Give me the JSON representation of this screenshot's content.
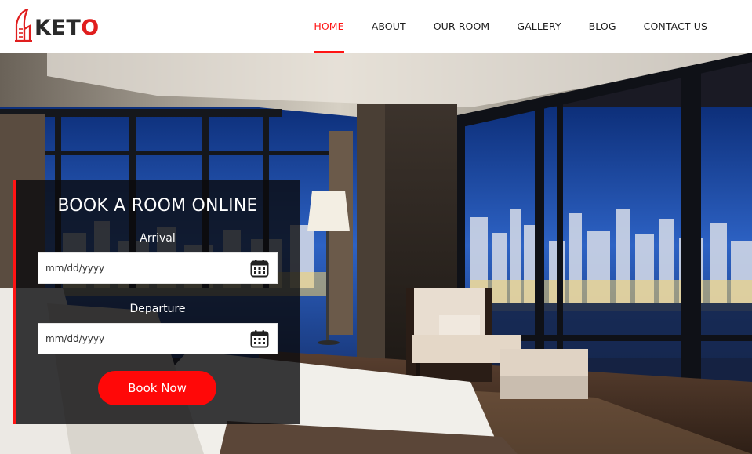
{
  "brand": {
    "name_prefix": "KET",
    "name_accent": "O",
    "logo_icon": "building-icon"
  },
  "nav": {
    "items": [
      {
        "label": "HOME",
        "active": true
      },
      {
        "label": "ABOUT",
        "active": false
      },
      {
        "label": "OUR ROOM",
        "active": false
      },
      {
        "label": "GALLERY",
        "active": false
      },
      {
        "label": "BLOG",
        "active": false
      },
      {
        "label": "CONTACT US",
        "active": false
      }
    ]
  },
  "booking": {
    "title": "BOOK A ROOM ONLINE",
    "arrival": {
      "label": "Arrival",
      "placeholder": "mm/dd/yyyy",
      "icon": "calendar-icon"
    },
    "departure": {
      "label": "Departure",
      "placeholder": "mm/dd/yyyy",
      "icon": "calendar-icon"
    },
    "submit_label": "Book Now"
  },
  "colors": {
    "accent": "#ff1414",
    "button": "#ff0808",
    "overlay": "#0a0a0c"
  }
}
